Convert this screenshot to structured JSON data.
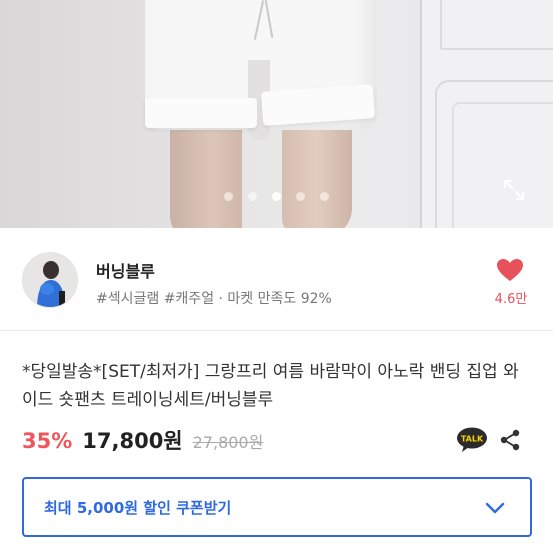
{
  "gallery": {
    "dots": [
      false,
      false,
      true,
      false,
      false
    ],
    "expand_icon": "expand-icon"
  },
  "seller": {
    "name": "버닝블루",
    "tags": "#섹시글램 #캐주얼 · 마켓 만족도 92%",
    "like_icon": "heart-icon",
    "like_count": "4.6만",
    "like_color": "#e8505b"
  },
  "product": {
    "title": "*당일발송*[SET/최저가] 그랑프리 여름 바람막이 아노락 밴딩 집업 와이드 숏팬츠 트레이닝세트/버닝블루",
    "discount": "35%",
    "price": "17,800원",
    "original_price": "27,800원",
    "discount_color": "#f2545b"
  },
  "actions": {
    "talk_label": "TALK",
    "share_icon": "share-icon"
  },
  "coupon": {
    "label": "최대 5,000원 할인 쿠폰받기",
    "accent": "#2f6ae0",
    "icon": "chevron-down-icon"
  }
}
